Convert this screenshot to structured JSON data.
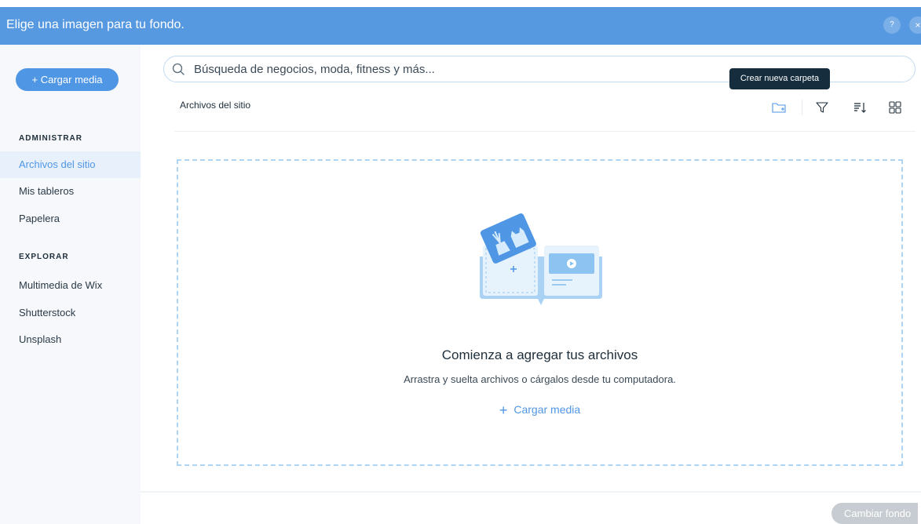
{
  "header": {
    "title": "Elige una imagen para tu fondo.",
    "help_label": "?",
    "close_label": "×"
  },
  "sidebar": {
    "upload_label": "+ Cargar media",
    "sections": [
      {
        "label": "ADMINISTRAR",
        "items": [
          {
            "label": "Archivos del sitio",
            "active": true
          },
          {
            "label": "Mis tableros",
            "active": false
          },
          {
            "label": "Papelera",
            "active": false
          }
        ]
      },
      {
        "label": "EXPLORAR",
        "items": [
          {
            "label": "Multimedia de Wix",
            "active": false
          },
          {
            "label": "Shutterstock",
            "active": false
          },
          {
            "label": "Unsplash",
            "active": false
          }
        ]
      }
    ]
  },
  "search": {
    "placeholder": "Búsqueda de negocios, moda, fitness y más...",
    "value": ""
  },
  "toolbar": {
    "breadcrumb": "Archivos del sitio",
    "tooltip": "Crear nueva carpeta",
    "icons": [
      "new-folder-icon",
      "filter-icon",
      "sort-icon",
      "grid-view-icon"
    ]
  },
  "empty_state": {
    "title": "Comienza a agregar tus archivos",
    "subtitle": "Arrastra y suelta archivos o cárgalos desde tu computadora.",
    "upload_label": "Cargar media",
    "upload_plus": "+"
  },
  "footer": {
    "change_bg_label": "Cambiar fondo"
  },
  "colors": {
    "header_bg": "#5699e0",
    "accent": "#4f96e5",
    "sidebar_bg": "#f6f8fb",
    "active_item_bg": "#e8f1fb",
    "dropzone_border": "#aed4f3",
    "disabled_button": "#c7ccd2",
    "tooltip_bg": "#162d3d"
  }
}
